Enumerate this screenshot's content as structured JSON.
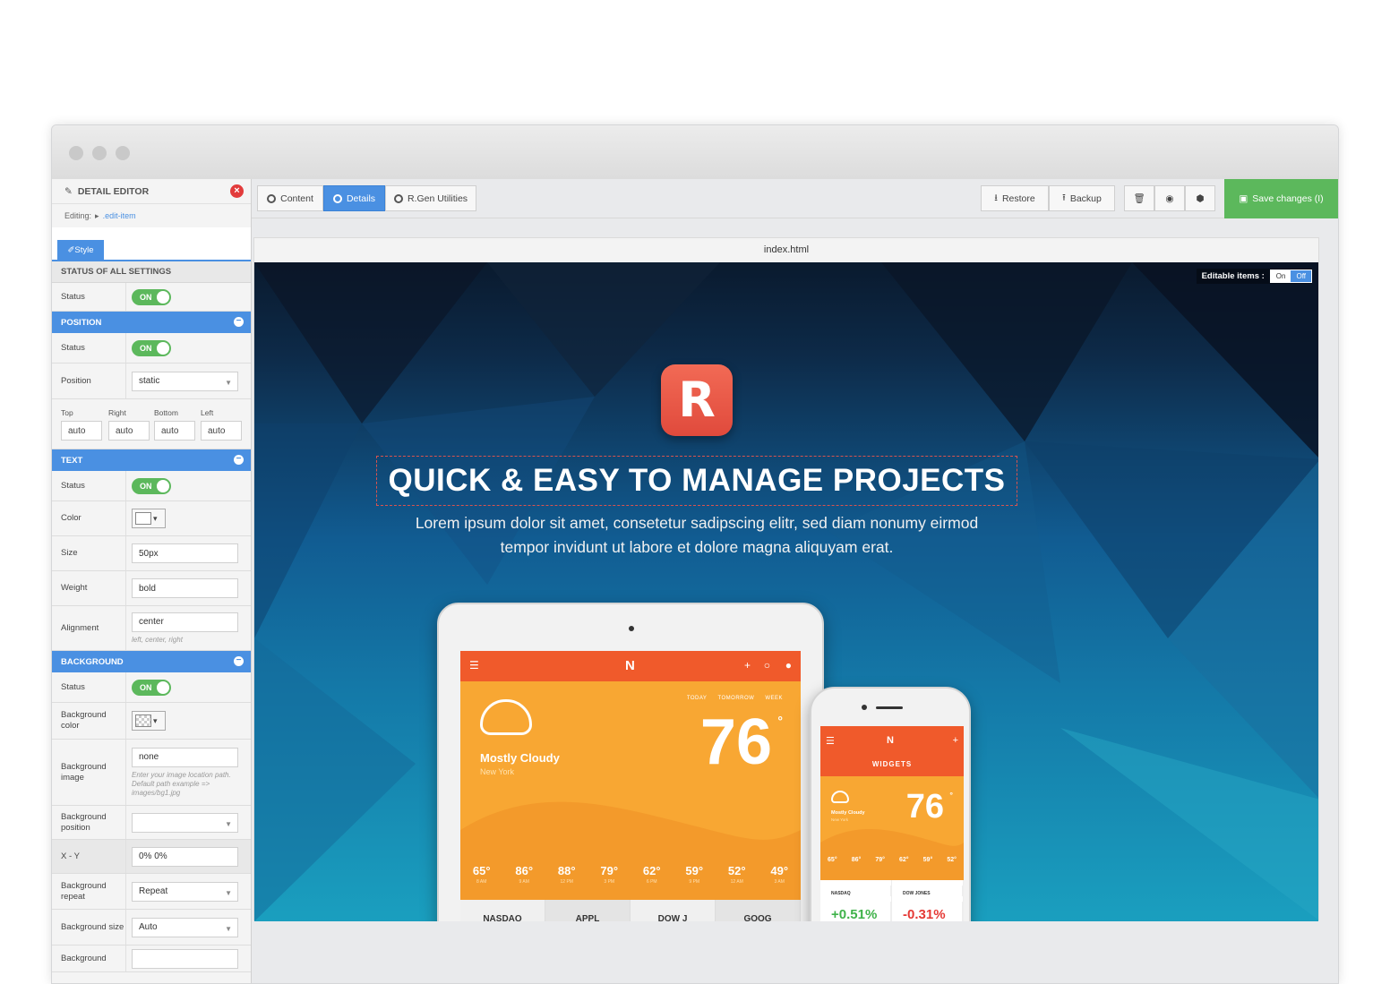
{
  "window": {
    "file_name": "index.html"
  },
  "toolbar": {
    "tabs": [
      {
        "label": "Content"
      },
      {
        "label": "Details"
      },
      {
        "label": "R.Gen Utilities"
      }
    ],
    "restore": "Restore",
    "backup": "Backup",
    "save": "Save changes (I)"
  },
  "sidebar": {
    "title": "DETAIL EDITOR",
    "editing_label": "Editing:",
    "editing_value": ".edit-item",
    "style_tab": "Style",
    "all_settings": {
      "header": "STATUS OF ALL SETTINGS",
      "status_label": "Status",
      "status": "ON"
    },
    "position": {
      "header": "POSITION",
      "status_label": "Status",
      "status": "ON",
      "position_label": "Position",
      "position_value": "static",
      "top_label": "Top",
      "right_label": "Right",
      "bottom_label": "Bottom",
      "left_label": "Left",
      "top": "auto",
      "right": "auto",
      "bottom": "auto",
      "left": "auto"
    },
    "text": {
      "header": "TEXT",
      "status_label": "Status",
      "status": "ON",
      "color_label": "Color",
      "size_label": "Size",
      "size": "50px",
      "weight_label": "Weight",
      "weight": "bold",
      "alignment_label": "Alignment",
      "alignment": "center",
      "alignment_hint": "left, center, right"
    },
    "background": {
      "header": "BACKGROUND",
      "status_label": "Status",
      "status": "ON",
      "color_label": "Background color",
      "image_label": "Background image",
      "image": "none",
      "image_hint": "Enter your image location path. Default path example => images/bg1.jpg",
      "position_label": "Background position",
      "position": "",
      "xy_label": "X - Y",
      "xy": "0% 0%",
      "repeat_label": "Background repeat",
      "repeat": "Repeat",
      "size_label": "Background size",
      "size": "Auto",
      "next_label": "Background"
    }
  },
  "hero": {
    "editable_label": "Editable items :",
    "editable_on": "On",
    "editable_off": "Off",
    "logo_letter": "R",
    "title": "QUICK & EASY TO MANAGE PROJECTS",
    "subtitle_line1": "Lorem ipsum dolor sit amet, consetetur sadipscing elitr, sed diam nonumy eirmod",
    "subtitle_line2": "tempor invidunt ut labore et dolore magna aliquyam erat."
  },
  "tablet": {
    "app_letter": "N",
    "tabs": [
      "TODAY",
      "TOMORROW",
      "WEEK"
    ],
    "condition": "Mostly Cloudy",
    "city": "New York",
    "temp": "76",
    "degree": "°",
    "hours": [
      {
        "t": "65°",
        "h": "8 AM"
      },
      {
        "t": "86°",
        "h": "9 AM"
      },
      {
        "t": "88°",
        "h": "12 PM"
      },
      {
        "t": "79°",
        "h": "3 PM"
      },
      {
        "t": "62°",
        "h": "6 PM"
      },
      {
        "t": "59°",
        "h": "9 PM"
      },
      {
        "t": "52°",
        "h": "12 AM"
      },
      {
        "t": "49°",
        "h": "3 AM"
      }
    ],
    "stocks": [
      "NASDAQ",
      "APPL",
      "DOW J",
      "GOOG"
    ]
  },
  "phone": {
    "app_letter": "N",
    "section": "WIDGETS",
    "condition": "Mostly Cloudy",
    "city": "New York",
    "temp": "76",
    "degree": "°",
    "hours": [
      "65°",
      "86°",
      "79°",
      "62°",
      "59°",
      "52°"
    ],
    "stock1_name": "NASDAQ",
    "stock1_value": "+0.51%",
    "stock2_name": "DOW JONES",
    "stock2_value": "-0.31%"
  },
  "colors": {
    "accent": "#4a90e2",
    "save": "#5cb85c",
    "close": "#e23b3b",
    "app_orange": "#f05a2b",
    "app_yellow": "#f8a733"
  }
}
